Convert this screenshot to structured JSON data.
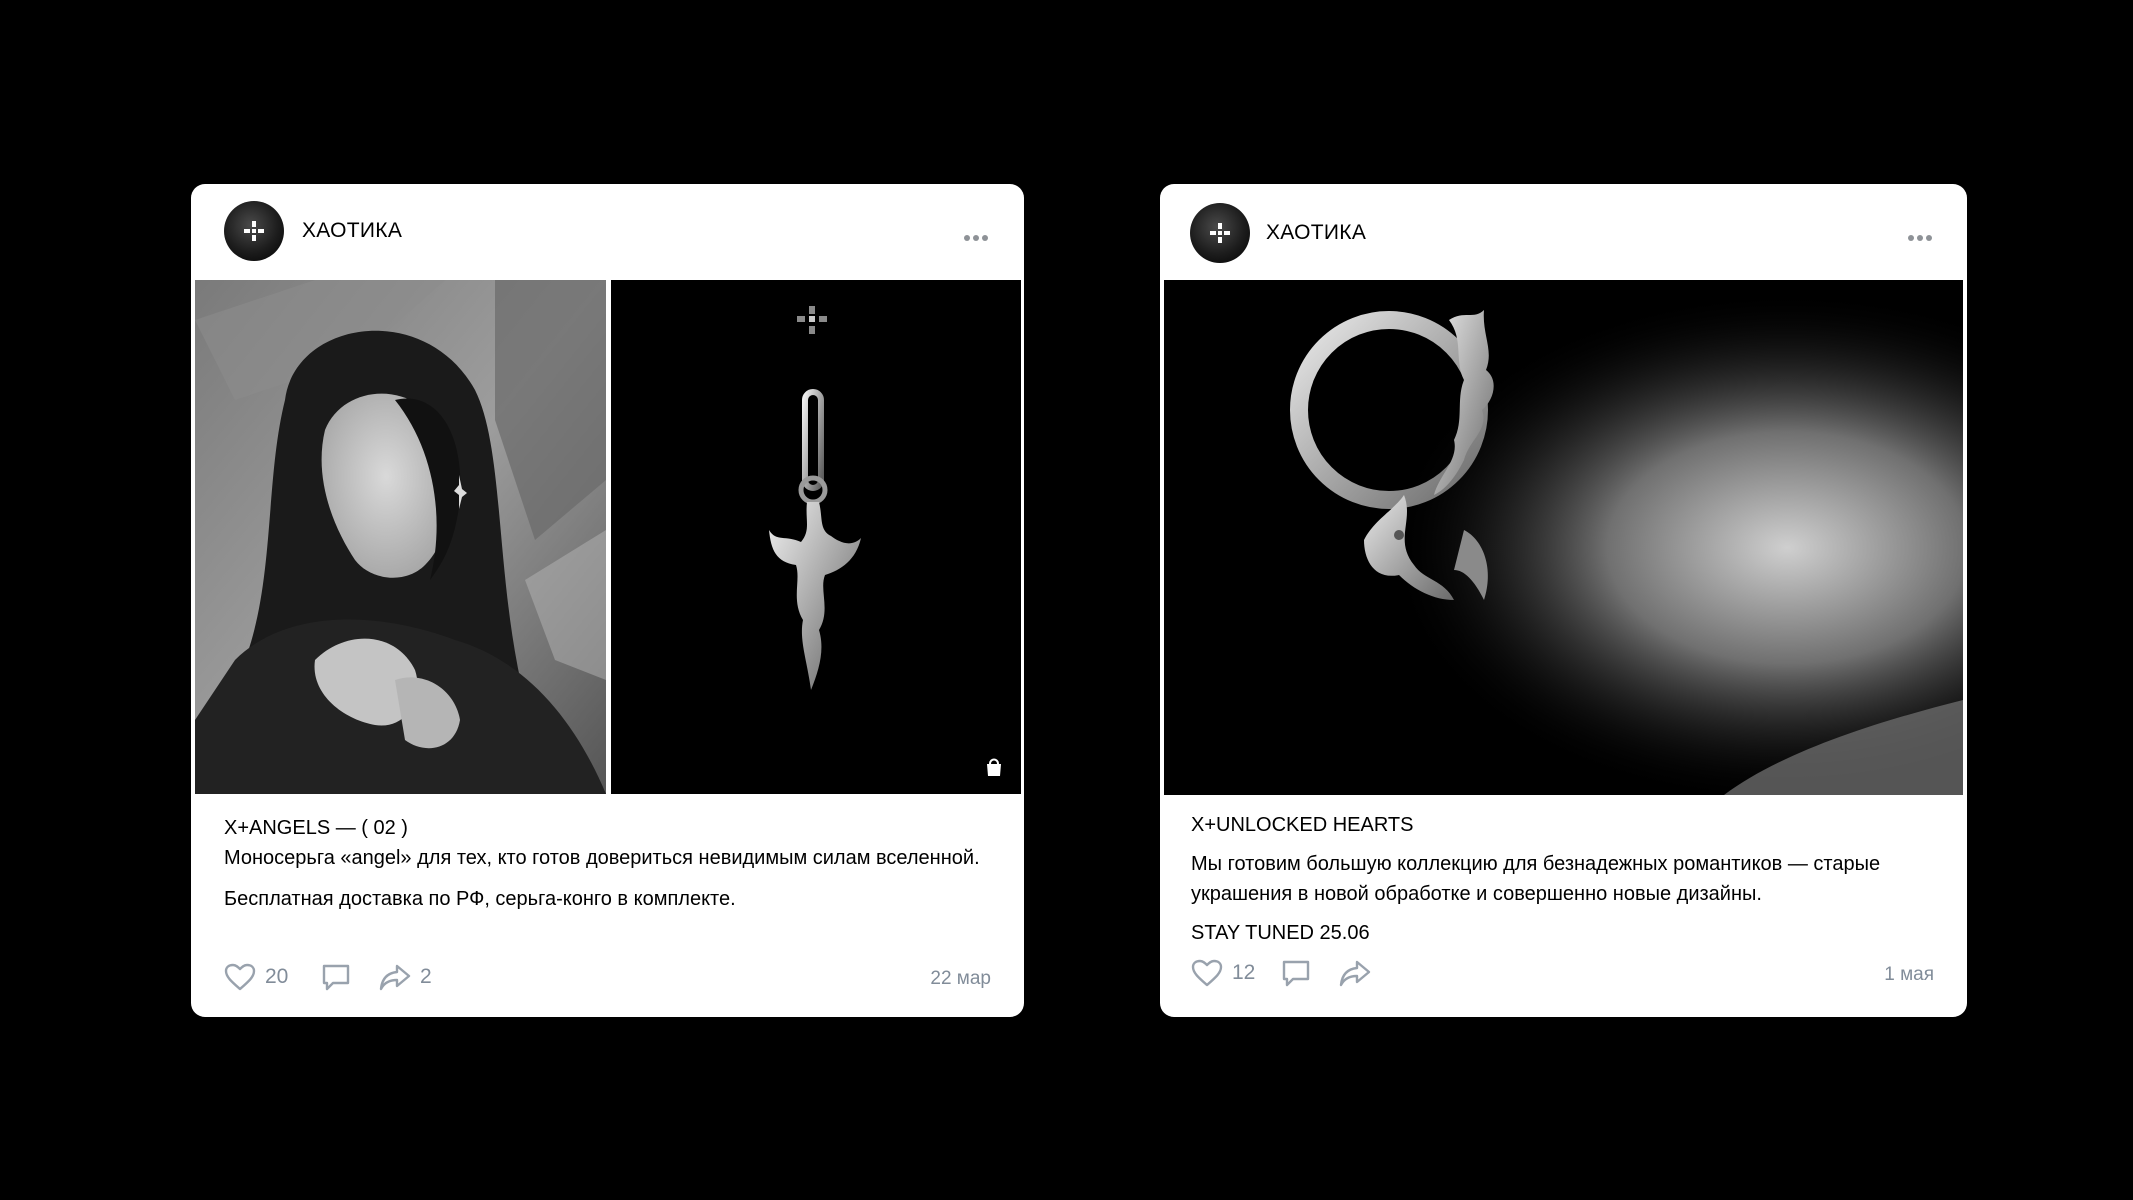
{
  "posts": [
    {
      "author": "ХАОТИКА",
      "title": "X+ANGELS — ( 02 )",
      "body": "Моносерьга «angel» для тех, кто готов довериться невидимым силам вселенной.",
      "body2": "Бесплатная доставка по РФ, серьга-конго в комплекте.",
      "likes": "20",
      "shares": "2",
      "date": "22 мар",
      "icons": {
        "avatar": "brand-cross-logo",
        "menu": "more-horizontal-icon",
        "like": "heart-icon",
        "comment": "comment-icon",
        "share": "share-arrow-icon",
        "product": "shopping-bag-icon"
      }
    },
    {
      "author": "ХАОТИКА",
      "title": "X+UNLOCKED HEARTS",
      "body": "Мы готовим большую коллекцию для безнадежных романтиков — старые украшения в новой обработке и совершенно новые дизайны.",
      "body2": "STAY TUNED 25.06",
      "likes": "12",
      "date": "1 мая"
    }
  ],
  "colors": {
    "page_bg": "#000000",
    "card_bg": "#ffffff",
    "meta_text": "#818c99",
    "icon": "#99a2ad"
  }
}
